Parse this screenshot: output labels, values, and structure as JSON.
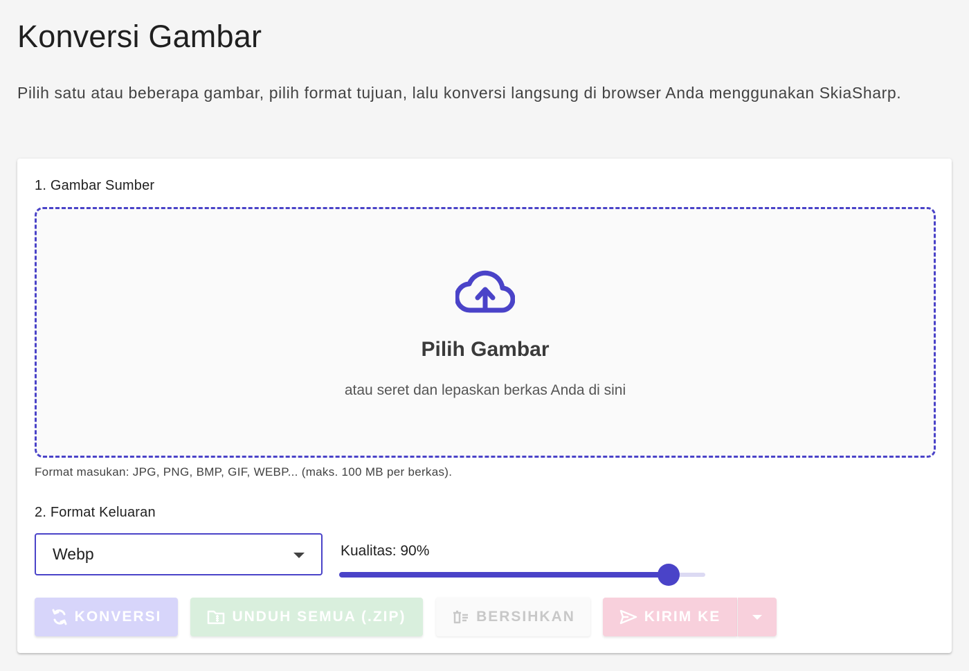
{
  "page": {
    "title": "Konversi Gambar",
    "description": "Pilih satu atau beberapa gambar, pilih format tujuan, lalu konversi langsung di browser Anda menggunakan SkiaSharp."
  },
  "source": {
    "section_title": "1. Gambar Sumber",
    "drop_title": "Pilih Gambar",
    "drop_subtitle": "atau seret dan lepaskan berkas Anda di sini",
    "format_hint": "Format masukan: JPG, PNG, BMP, GIF, WEBP... (maks. 100 MB per berkas).",
    "icon": "cloud-upload-icon"
  },
  "output": {
    "section_title": "2. Format Keluaran",
    "selected_format": "Webp",
    "quality_label": "Kualitas: 90%",
    "quality_value": 90,
    "quality_max": 100
  },
  "actions": {
    "convert": "KONVERSI",
    "download_zip": "UNDUH SEMUA (.ZIP)",
    "clear": "BERSIHKAN",
    "send_to": "KIRIM KE"
  },
  "colors": {
    "primary": "#4a43c8",
    "convert_disabled": "#d7d5fa",
    "zip_disabled": "#d9efdd",
    "send_disabled": "#f8d0dc"
  }
}
